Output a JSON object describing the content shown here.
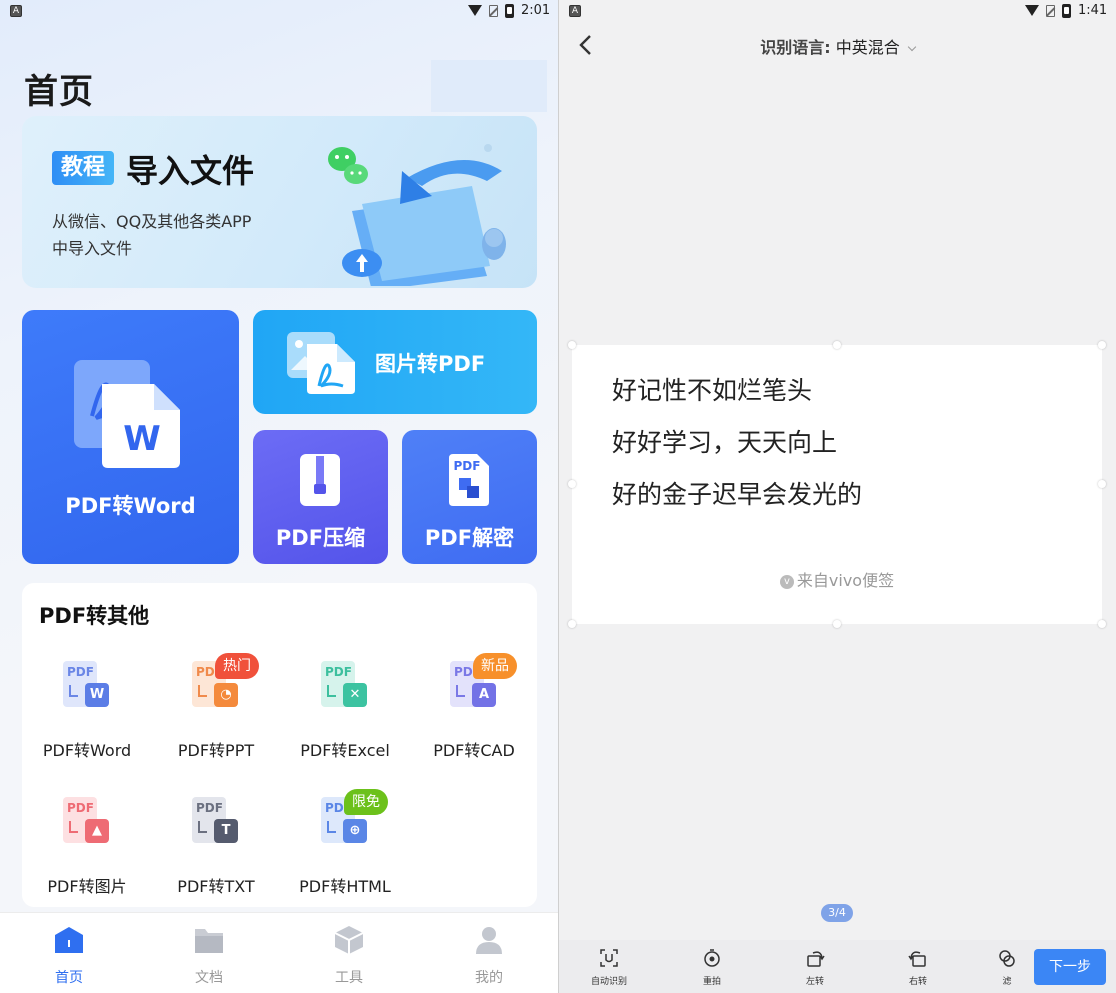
{
  "left": {
    "status": {
      "time": "2:01"
    },
    "page_title": "首页",
    "banner": {
      "tag": "教程",
      "headline": "导入文件",
      "desc_line1": "从微信、QQ及其他各类APP",
      "desc_line2": "中导入文件"
    },
    "cards": {
      "pdf_to_word": "PDF转Word",
      "image_to_pdf": "图片转PDF",
      "pdf_compress": "PDF压缩",
      "pdf_decrypt": "PDF解密"
    },
    "tools_section": {
      "title": "PDF转其他",
      "items": [
        {
          "label": "PDF转Word",
          "badge": ""
        },
        {
          "label": "PDF转PPT",
          "badge": "热门"
        },
        {
          "label": "PDF转Excel",
          "badge": ""
        },
        {
          "label": "PDF转CAD",
          "badge": "新品"
        },
        {
          "label": "PDF转图片",
          "badge": ""
        },
        {
          "label": "PDF转TXT",
          "badge": ""
        },
        {
          "label": "PDF转HTML",
          "badge": "限免"
        }
      ]
    },
    "tabbar": [
      {
        "label": "首页",
        "icon": "home-icon",
        "active": true
      },
      {
        "label": "文档",
        "icon": "folder-icon",
        "active": false
      },
      {
        "label": "工具",
        "icon": "cube-icon",
        "active": false
      },
      {
        "label": "我的",
        "icon": "person-icon",
        "active": false
      }
    ]
  },
  "right": {
    "status": {
      "time": "1:41"
    },
    "language": {
      "label": "识别语言:",
      "value": "中英混合"
    },
    "scanned_text": {
      "line1": "好记性不如烂笔头",
      "line2": "好好学习，天天向上",
      "line3": "好的金子迟早会发光的",
      "source": "来自vivo便签"
    },
    "pager": "3/4",
    "toolbar": {
      "auto_detect": "自动识别",
      "retake": "重拍",
      "rotate_left": "左转",
      "rotate_right": "右转",
      "filter": "滤",
      "next": "下一步"
    }
  },
  "colors": {
    "primary_blue": "#3266ee",
    "sky_blue": "#20a6f5",
    "purple": "#5454ea",
    "hot_red": "#f0513b",
    "new_orange": "#f7902b",
    "free_green": "#6cc11b",
    "next_button": "#3b86f5"
  }
}
